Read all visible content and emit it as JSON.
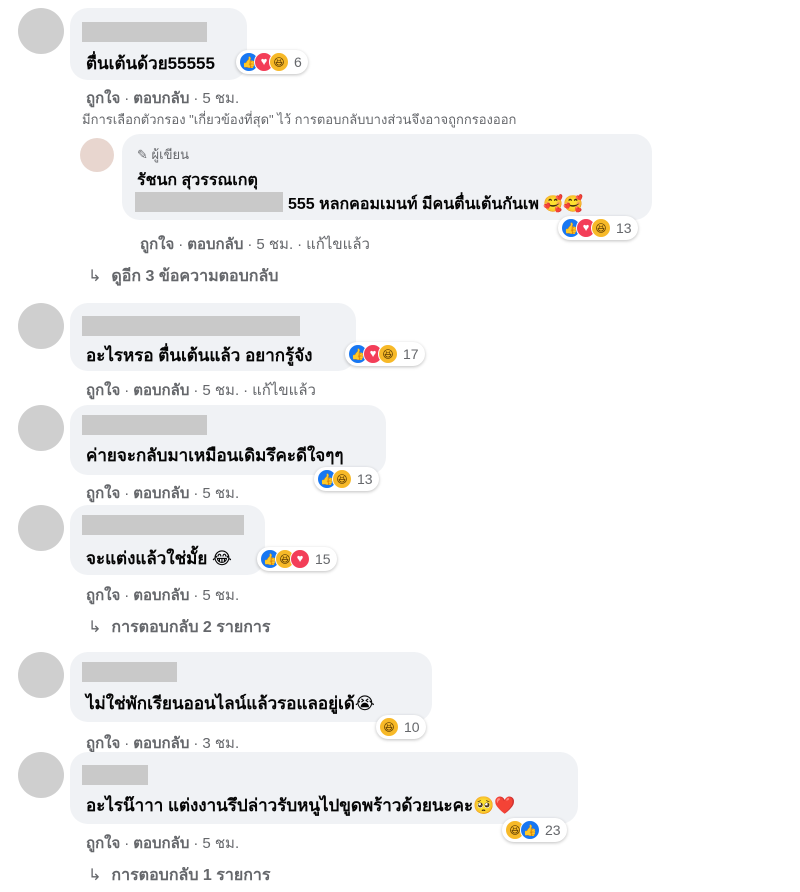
{
  "colors": {
    "bubble": "#f0f2f5",
    "meta": "#65676b",
    "like": "#1877f2",
    "love": "#f33e58",
    "haha": "#f7b928"
  },
  "comments": [
    {
      "text": "ตื่นเต้นด้วย55555",
      "reactions": [
        "like-icon",
        "love-icon",
        "haha-icon"
      ],
      "count": "6",
      "like": "ถูกใจ",
      "reply": "ตอบกลับ",
      "time": "5 ชม."
    },
    {
      "text": "อะไรหรอ ตื่นเต้นแล้ว อยากรู้จัง",
      "reactions": [
        "like-icon",
        "love-icon",
        "haha-icon"
      ],
      "count": "17",
      "like": "ถูกใจ",
      "reply": "ตอบกลับ",
      "time": "5 ชม.",
      "edited": "แก้ไขแล้ว"
    },
    {
      "text": "ค่ายจะกลับมาเหมือนเดิมรึคะดีใจๆๆ",
      "reactions": [
        "like-icon",
        "haha-icon"
      ],
      "count": "13",
      "like": "ถูกใจ",
      "reply": "ตอบกลับ",
      "time": "5 ชม."
    },
    {
      "text": "จะแต่งแล้วใช่มั้ย 😂",
      "reactions": [
        "like-icon",
        "haha-icon",
        "love-icon"
      ],
      "count": "15",
      "like": "ถูกใจ",
      "reply": "ตอบกลับ",
      "time": "5 ชม.",
      "replies_link": "การตอบกลับ 2 รายการ"
    },
    {
      "text": "ไม่ใช่พักเรียนออนไลน์แล้วรอแลอยู่เด้😭",
      "reactions": [
        "haha-icon"
      ],
      "count": "10",
      "like": "ถูกใจ",
      "reply": "ตอบกลับ",
      "time": "3 ชม."
    },
    {
      "text": "อะไรน๊าาา แต่งงานรึปล่าวรับหนูไปขูดพร้าวด้วยนะคะ🥺❤️",
      "reactions": [
        "haha-icon",
        "like-icon"
      ],
      "count": "23",
      "like": "ถูกใจ",
      "reply": "ตอบกลับ",
      "time": "5 ชม.",
      "replies_link": "การตอบกลับ 1 รายการ"
    }
  ],
  "filter_note": "มีการเลือกตัวกรอง \"เกี่ยวข้องที่สุด\" ไว้ การตอบกลับบางส่วนจึงอาจถูกกรองออก",
  "author_reply": {
    "badge": "ผู้เขียน",
    "name": "รัชนก สุวรรณเกตุ",
    "text": "555 หลกคอมเมนท์ มีคนตื่นเต้นกันเพ 🥰🥰",
    "reactions": [
      "like-icon",
      "love-icon",
      "haha-icon"
    ],
    "count": "13",
    "like": "ถูกใจ",
    "reply": "ตอบกลับ",
    "time": "5 ชม.",
    "edited": "แก้ไขแล้ว"
  },
  "view_more": "ดูอีก 3 ข้อความตอบกลับ"
}
